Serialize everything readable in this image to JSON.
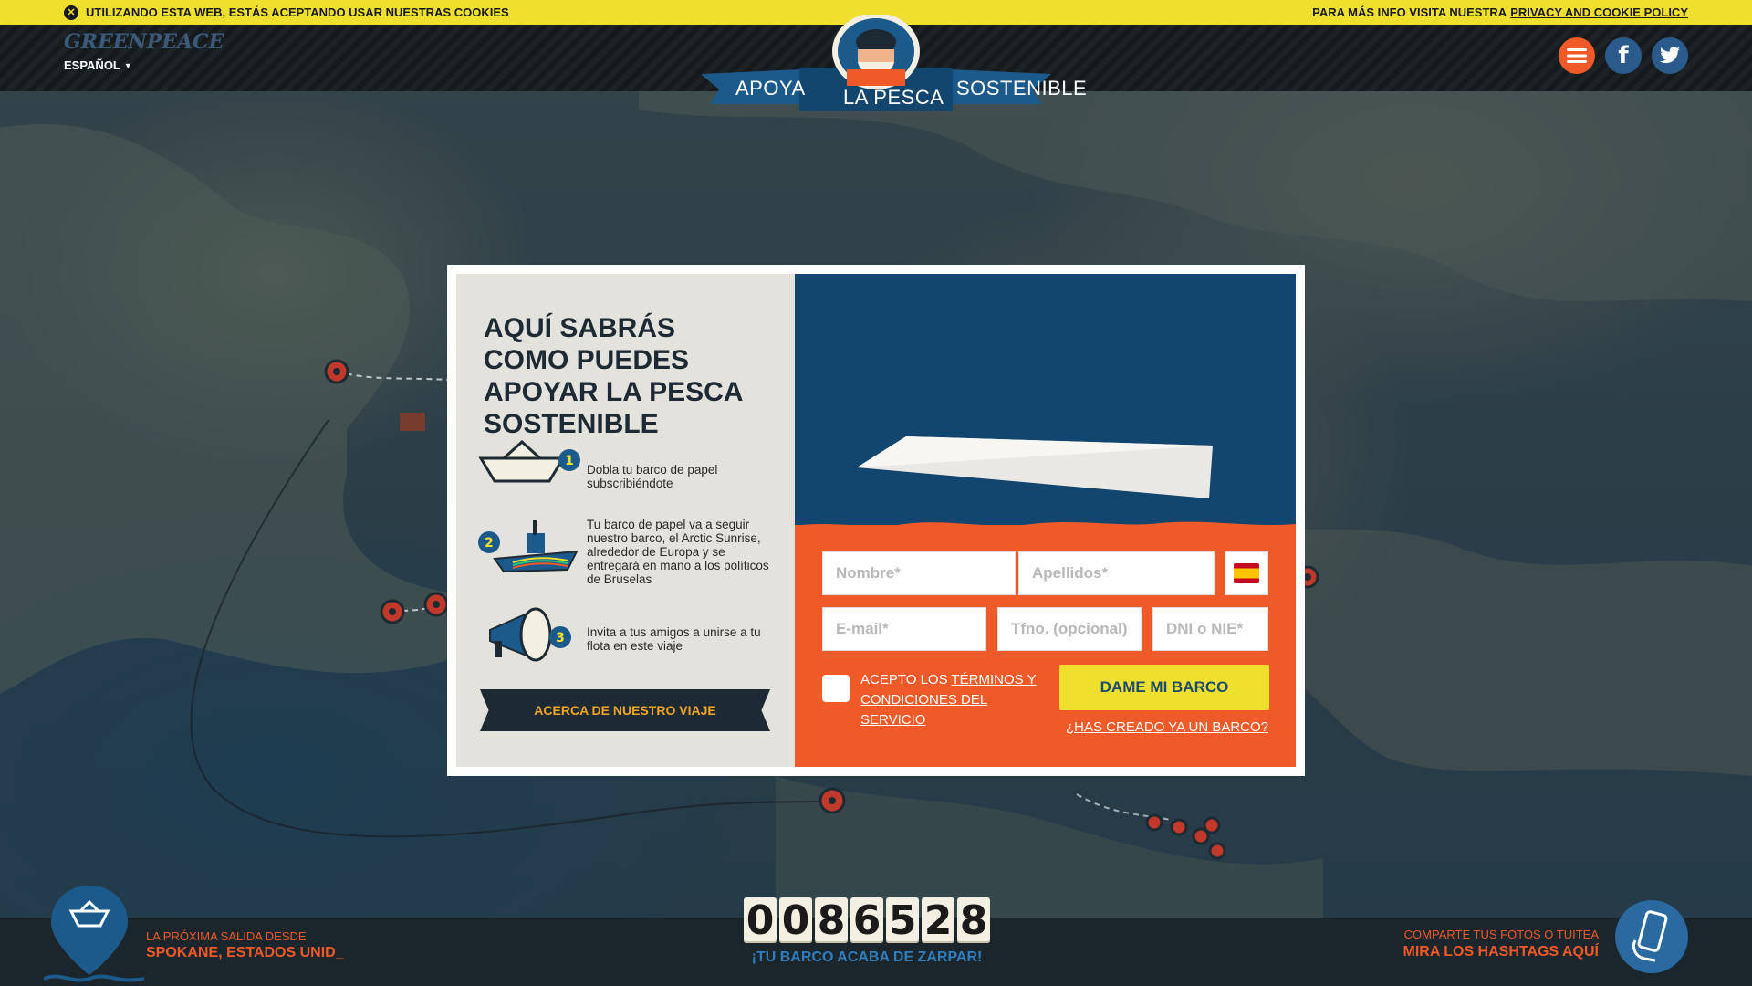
{
  "cookie_bar": {
    "close_icon": "close-icon",
    "message": "Utilizando esta web, estás aceptando usar nuestras cookies",
    "info_prefix": "Para más info visita nuestra",
    "policy_link": "Privacy and cookie policy"
  },
  "header": {
    "logo": "GREENPEACE",
    "language": "ESPAÑOL",
    "banner": {
      "left": "APOYA",
      "center": "LA PESCA",
      "right": "SOSTENIBLE"
    },
    "social": [
      "menu-icon",
      "facebook-icon",
      "twitter-icon"
    ]
  },
  "modal": {
    "title": "AQUÍ SABRÁS COMO PUEDES APOYAR LA PESCA SOSTENIBLE",
    "steps": [
      {
        "number": "1",
        "icon": "paper-boat-icon",
        "text": "Dobla tu barco de papel subscribiéndote"
      },
      {
        "number": "2",
        "icon": "ship-icon",
        "text": "Tu barco de papel va a seguir nuestro barco, el Arctic Sunrise, alrededor de Europa y se entregará en mano a los políticos de Bruselas"
      },
      {
        "number": "3",
        "icon": "megaphone-icon",
        "text": "Invita a tus amigos a unirse a tu flota en este viaje"
      }
    ],
    "about_button": "ACERCA DE NUESTRO VIAJE",
    "form": {
      "first_name_placeholder": "Nombre*",
      "last_name_placeholder": "Apellidos*",
      "country_flag": "spain-flag-icon",
      "email_placeholder": "E-mail*",
      "phone_placeholder": "Tfno. (opcional)",
      "id_placeholder": "DNI o NIE*",
      "terms_prefix": "Acepto los",
      "terms_link": "términos y condiciones del servicio",
      "submit": "Dame mi barco",
      "already_created": "¿Has creado ya un barco?"
    }
  },
  "footer": {
    "next_departure_label": "La próxima salida desde",
    "next_departure_city": "SPOKANE, ESTADOS UNID_",
    "counter_digits": [
      "0",
      "0",
      "8",
      "6",
      "5",
      "2",
      "8"
    ],
    "counter_caption": "¡Tu barco acaba de zarpar!",
    "share_label": "Comparte tus fotos o tuitea",
    "share_link": "Mira los hashtags aquí",
    "phone_icon": "phone-icon"
  },
  "colors": {
    "cookie_bar": "#f0e02e",
    "orange": "#f05a28",
    "navy": "#13466e",
    "dark": "#1d2a33"
  }
}
